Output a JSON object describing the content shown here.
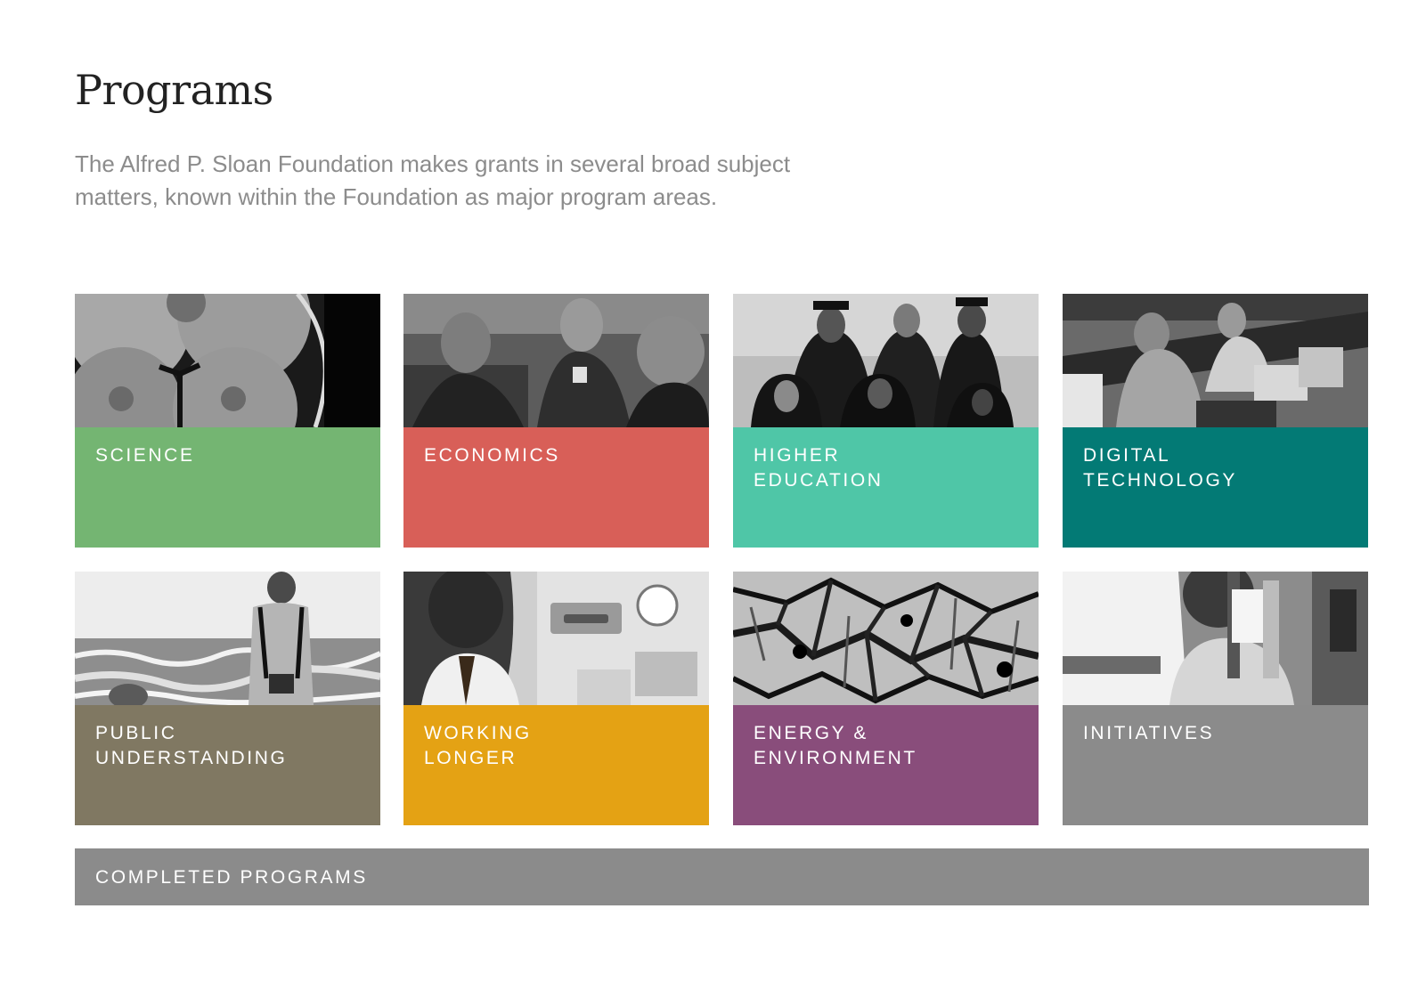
{
  "header": {
    "title": "Programs",
    "intro": "The Alfred P. Sloan Foundation makes grants in several broad subject matters, known within the Foundation as major program areas."
  },
  "programs": [
    {
      "label": "SCIENCE",
      "color": "#74b572",
      "photo": "petri-dish-photo"
    },
    {
      "label": "ECONOMICS",
      "color": "#d85f58",
      "photo": "conference-discussion-photo"
    },
    {
      "label": "HIGHER\nEDUCATION",
      "color": "#4fc6a7",
      "photo": "graduates-photo"
    },
    {
      "label": "DIGITAL\nTECHNOLOGY",
      "color": "#037a75",
      "photo": "laptop-workshop-photo"
    },
    {
      "label": "PUBLIC\nUNDERSTANDING",
      "color": "#807862",
      "photo": "beach-recordist-photo"
    },
    {
      "label": "WORKING\nLONGER",
      "color": "#e4a214",
      "photo": "lab-worker-photo"
    },
    {
      "label": "ENERGY &\nENVIRONMENT",
      "color": "#894d7b",
      "photo": "crackled-surface-photo"
    },
    {
      "label": "INITIATIVES",
      "color": "#8b8b8b",
      "photo": "pipette-scientist-photo"
    }
  ],
  "completed": {
    "label": "COMPLETED PROGRAMS",
    "color": "#8b8b8b"
  }
}
